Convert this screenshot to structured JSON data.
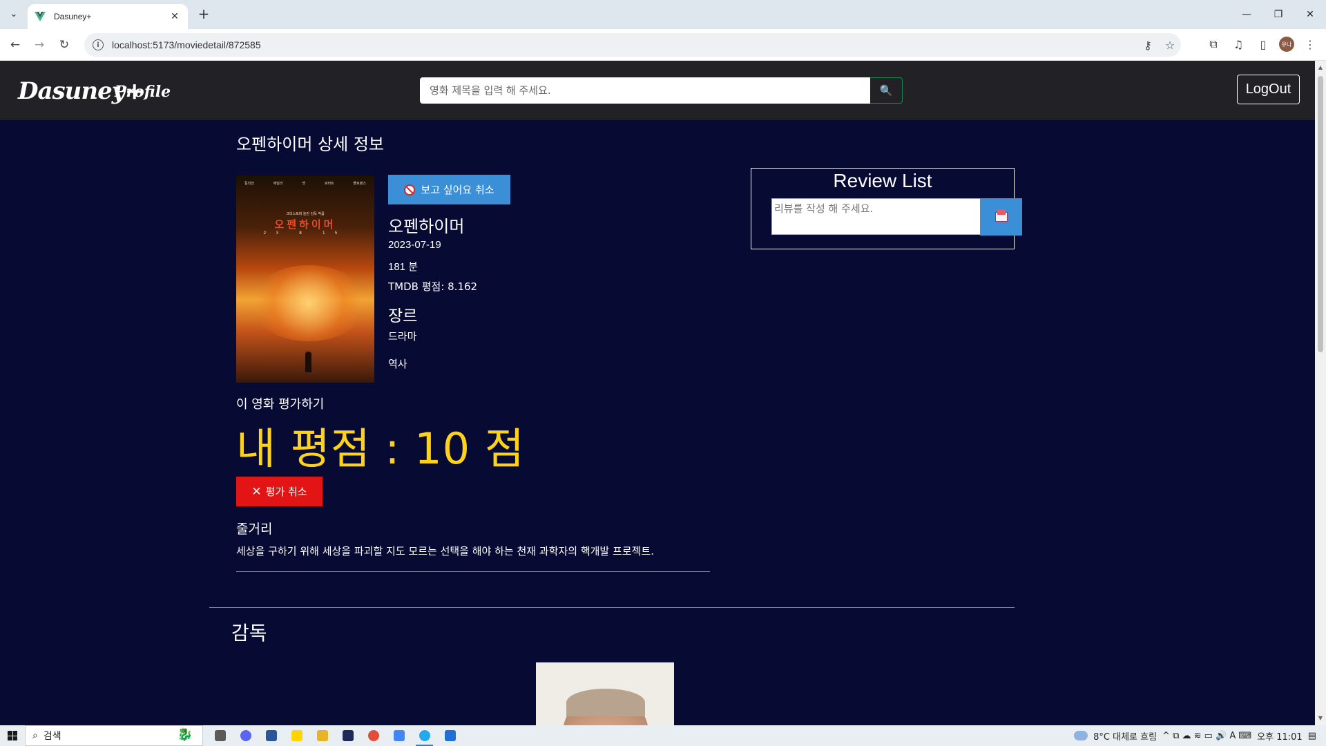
{
  "browser": {
    "tab_title": "Dasuney+",
    "tab_list_glyph": "⌄",
    "tab_close_glyph": "✕",
    "new_tab_glyph": "+",
    "url": "localhost:5173/moviedetail/872585",
    "window_controls": [
      "—",
      "❐",
      "✕"
    ],
    "nav_glyphs": {
      "back": "←",
      "forward": "→",
      "reload": "↻",
      "info": "i"
    },
    "omnibox_glyphs": {
      "key": "⚷",
      "star": "☆"
    },
    "toolbar_glyphs": {
      "extensions": "⧉",
      "media": "♫",
      "side_panel": "▯",
      "menu": "⋮"
    },
    "profile_initials": "유나"
  },
  "header": {
    "logo": "Dasuney+",
    "profile_link": "Profile",
    "search_placeholder": "영화 제목을 입력 해 주세요.",
    "search_glyph": "🔍",
    "logout_label": "LogOut"
  },
  "detail": {
    "page_title": "오펜하이머 상세 정보",
    "wishlist_button": "보고 싶어요 취소",
    "movie_title": "오펜하이머",
    "release_date": "2023-07-19",
    "runtime": "181 분",
    "tmdb_rating": "TMDB 평점: 8.162",
    "genre_heading": "장르",
    "genres": [
      "드라마",
      "역사"
    ],
    "rate_label": "이 영화 평가하기",
    "my_score": "내 평점 : 10 점",
    "cancel_rating_button": "평가 취소",
    "cancel_glyph": "✕",
    "synopsis_heading": "줄거리",
    "synopsis": "세상을 구하기 위해 세상을 파괴할 지도 모르는 선택을 해야 하는 천재 과학자의 핵개발 프로젝트.",
    "director_heading": "감독"
  },
  "poster": {
    "title_text": "오펜하이머",
    "tagline": "크리스토퍼 놀란 감독 작품",
    "date_text": "23 8 15",
    "cast": [
      "킬리언",
      "에밀리",
      "맷",
      "로버트",
      "플로렌스"
    ]
  },
  "review": {
    "title": "Review List",
    "placeholder": "리뷰를 작성 해 주세요."
  },
  "taskbar": {
    "search_label": "검색",
    "search_glyph": "⌕",
    "weather": "8°C  대체로 흐림",
    "tray_icons": "^  ⧉  ☁  ≋  ▭  🔊  A  ⌨",
    "time": "오후 11:01",
    "notification_glyph": "▤",
    "app_colors": [
      "#5a5a5a",
      "#5865f2",
      "#2b579a",
      "#ffd400",
      "#e8b427",
      "#1e2a5a",
      "#e44d3a",
      "#4285f4",
      "#23a9f2",
      "#1f6fd6"
    ]
  }
}
